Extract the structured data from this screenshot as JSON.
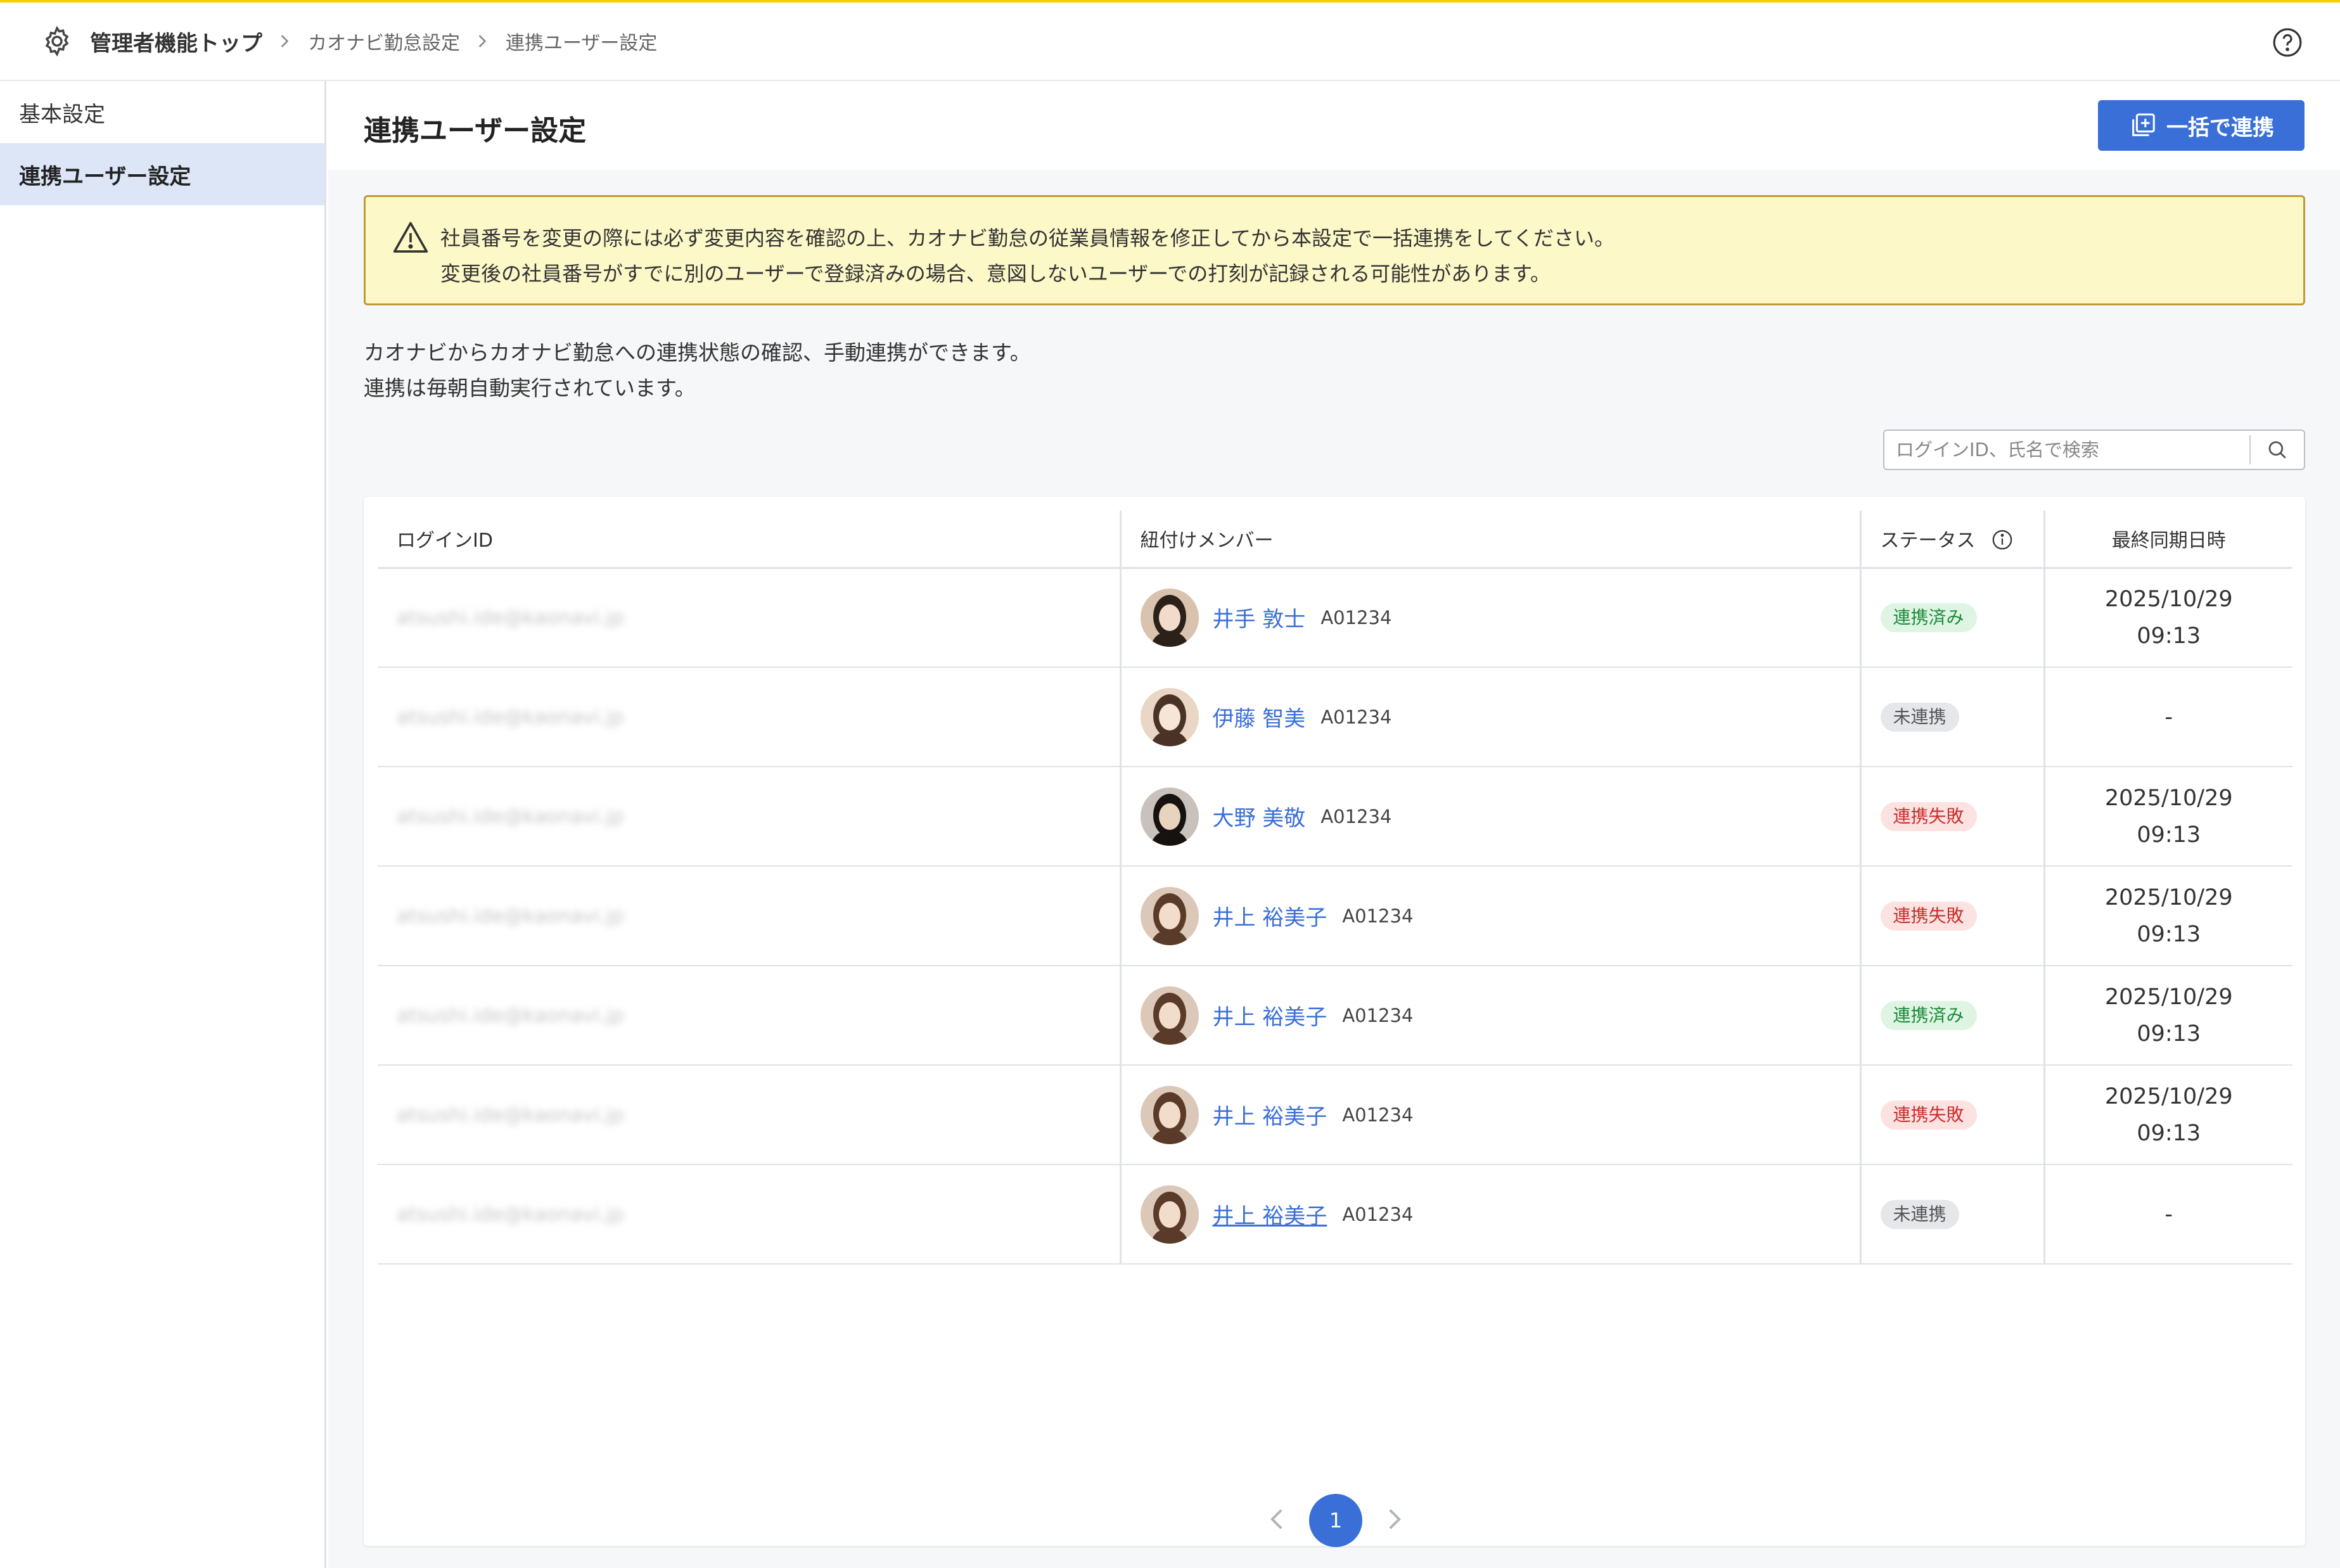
{
  "header": {
    "breadcrumb": [
      "管理者機能トップ",
      "カオナビ勤怠設定",
      "連携ユーザー設定"
    ]
  },
  "sidebar": {
    "items": [
      {
        "label": "基本設定"
      },
      {
        "label": "連携ユーザー設定"
      }
    ],
    "active_index": 1
  },
  "main": {
    "title": "連携ユーザー設定",
    "bulk_button_label": "一括で連携",
    "warning": [
      "社員番号を変更の際には必ず変更内容を確認の上、カオナビ勤怠の従業員情報を修正してから本設定で一括連携をしてください。",
      "変更後の社員番号がすでに別のユーザーで登録済みの場合、意図しないユーザーでの打刻が記録される可能性があります。"
    ],
    "description": [
      "カオナビからカオナビ勤怠への連携状態の確認、手動連携ができます。",
      "連携は毎朝自動実行されています。"
    ],
    "search": {
      "placeholder": "ログインID、氏名で検索"
    },
    "table": {
      "columns": [
        "ログインID",
        "紐付けメンバー",
        "ステータス",
        "最終同期日時"
      ],
      "rows": [
        {
          "login_id": "atsushi.ide@kaonavi.jp",
          "name": "井手 敦士",
          "code": "A01234",
          "status": "連携済み",
          "status_kind": "success",
          "date": "2025/10/29",
          "time": "09:13"
        },
        {
          "login_id": "atsushi.ide@kaonavi.jp",
          "name": "伊藤 智美",
          "code": "A01234",
          "status": "未連携",
          "status_kind": "unlinked",
          "date": "-",
          "time": ""
        },
        {
          "login_id": "atsushi.ide@kaonavi.jp",
          "name": "大野 美敬",
          "code": "A01234",
          "status": "連携失敗",
          "status_kind": "failed",
          "date": "2025/10/29",
          "time": "09:13"
        },
        {
          "login_id": "atsushi.ide@kaonavi.jp",
          "name": "井上 裕美子",
          "code": "A01234",
          "status": "連携失敗",
          "status_kind": "failed",
          "date": "2025/10/29",
          "time": "09:13"
        },
        {
          "login_id": "atsushi.ide@kaonavi.jp",
          "name": "井上 裕美子",
          "code": "A01234",
          "status": "連携済み",
          "status_kind": "success",
          "date": "2025/10/29",
          "time": "09:13"
        },
        {
          "login_id": "atsushi.ide@kaonavi.jp",
          "name": "井上 裕美子",
          "code": "A01234",
          "status": "連携失敗",
          "status_kind": "failed",
          "date": "2025/10/29",
          "time": "09:13"
        },
        {
          "login_id": "atsushi.ide@kaonavi.jp",
          "name": "井上 裕美子",
          "code": "A01234",
          "status": "未連携",
          "status_kind": "unlinked",
          "date": "-",
          "time": ""
        }
      ]
    },
    "pagination": {
      "current_page": "1"
    }
  },
  "icons": {
    "settings": "gear-icon",
    "help": "help-icon",
    "warning": "warning-icon",
    "search": "search-icon",
    "info": "info-icon",
    "bulk": "plus-icon"
  },
  "colors": {
    "accent": "#3a6fd8",
    "header_border": "#f5d000",
    "warning_bg": "#fdf8c8",
    "warning_border": "#c09a3a",
    "success": "#1e8a3c",
    "failed": "#c9302c",
    "sidebar_active": "#dce6f7"
  }
}
